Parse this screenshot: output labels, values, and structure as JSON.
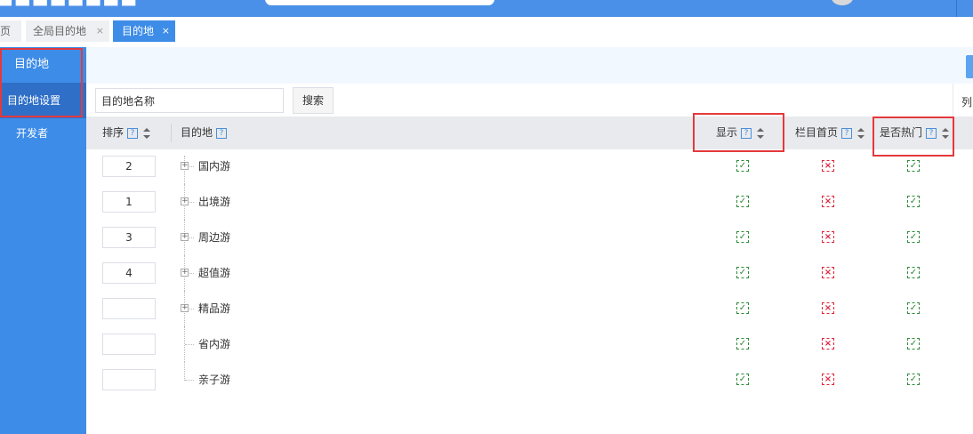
{
  "topbar": {
    "accent": "#4a90e8"
  },
  "tabs": [
    {
      "label": "页",
      "closable": false,
      "active": false
    },
    {
      "label": "全局目的地",
      "closable": true,
      "active": false
    },
    {
      "label": "目的地",
      "closable": true,
      "active": true
    }
  ],
  "tab_close_glyph": "×",
  "sidebar": {
    "section_title": "目的地",
    "items": [
      {
        "label": "目的地设置",
        "active": true
      },
      {
        "label": "开发者",
        "active": false
      }
    ]
  },
  "search": {
    "value": "目的地名称",
    "button_label": "搜索"
  },
  "column_settings_label": "列",
  "table": {
    "help_glyph": "?",
    "columns": {
      "order": "排序",
      "destination": "目的地",
      "show": "显示",
      "column_home": "栏目首页",
      "is_hot": "是否热门"
    },
    "rows": [
      {
        "order": "2",
        "name": "国内游",
        "expandable": true,
        "show": true,
        "column_home": false,
        "is_hot": true
      },
      {
        "order": "1",
        "name": "出境游",
        "expandable": true,
        "show": true,
        "column_home": false,
        "is_hot": true
      },
      {
        "order": "3",
        "name": "周边游",
        "expandable": true,
        "show": true,
        "column_home": false,
        "is_hot": true
      },
      {
        "order": "4",
        "name": "超值游",
        "expandable": true,
        "show": true,
        "column_home": false,
        "is_hot": true
      },
      {
        "order": "",
        "name": "精品游",
        "expandable": true,
        "show": true,
        "column_home": false,
        "is_hot": true
      },
      {
        "order": "",
        "name": "省内游",
        "expandable": false,
        "show": true,
        "column_home": false,
        "is_hot": true
      },
      {
        "order": "",
        "name": "亲子游",
        "expandable": false,
        "show": true,
        "column_home": false,
        "is_hot": true
      }
    ]
  },
  "status_colors": {
    "checked": "#2e8b3a",
    "unchecked": "#e0253b",
    "highlight": "#e4393c"
  }
}
